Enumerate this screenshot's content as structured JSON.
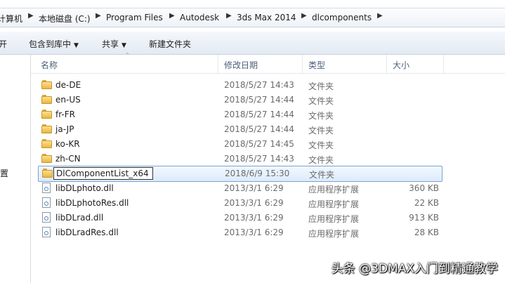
{
  "breadcrumb": [
    "计算机",
    "本地磁盘 (C:)",
    "Program Files",
    "Autodesk",
    "3ds Max 2014",
    "dlcomponents"
  ],
  "toolbar": {
    "open_label": "开",
    "include_label": "包含到库中",
    "share_label": "共享",
    "new_folder_label": "新建文件夹"
  },
  "nav": {
    "partial_label": "置"
  },
  "columns": {
    "name": "名称",
    "date": "修改日期",
    "type": "类型",
    "size": "大小"
  },
  "rows": [
    {
      "name": "de-DE",
      "date": "2018/5/27 14:43",
      "type": "文件夹",
      "size": "",
      "icon": "folder-icon"
    },
    {
      "name": "en-US",
      "date": "2018/5/27 14:44",
      "type": "文件夹",
      "size": "",
      "icon": "folder-icon"
    },
    {
      "name": "fr-FR",
      "date": "2018/5/27 14:44",
      "type": "文件夹",
      "size": "",
      "icon": "folder-icon"
    },
    {
      "name": "ja-JP",
      "date": "2018/5/27 14:44",
      "type": "文件夹",
      "size": "",
      "icon": "folder-icon"
    },
    {
      "name": "ko-KR",
      "date": "2018/5/27 14:45",
      "type": "文件夹",
      "size": "",
      "icon": "folder-icon"
    },
    {
      "name": "zh-CN",
      "date": "2018/5/27 14:43",
      "type": "文件夹",
      "size": "",
      "icon": "folder-icon"
    },
    {
      "name": "DlComponentList_x64",
      "date": "2018/6/9 15:30",
      "type": "文件夹",
      "size": "",
      "icon": "folder-icon"
    },
    {
      "name": "libDLphoto.dll",
      "date": "2013/3/1 6:29",
      "type": "应用程序扩展",
      "size": "360 KB",
      "icon": "dll-file-icon"
    },
    {
      "name": "libDLphotoRes.dll",
      "date": "2013/3/1 6:29",
      "type": "应用程序扩展",
      "size": "22 KB",
      "icon": "dll-file-icon"
    },
    {
      "name": "libDLrad.dll",
      "date": "2013/3/1 6:29",
      "type": "应用程序扩展",
      "size": "913 KB",
      "icon": "dll-file-icon"
    },
    {
      "name": "libDLradRes.dll",
      "date": "2013/3/1 6:29",
      "type": "应用程序扩展",
      "size": "28 KB",
      "icon": "dll-file-icon"
    }
  ],
  "watermark": "头条 @3DMAX入门到精通教学",
  "colors": {
    "selection_border": "#7da2ce",
    "selection_fill": "#dcebfc",
    "folder": "#e9b646"
  }
}
